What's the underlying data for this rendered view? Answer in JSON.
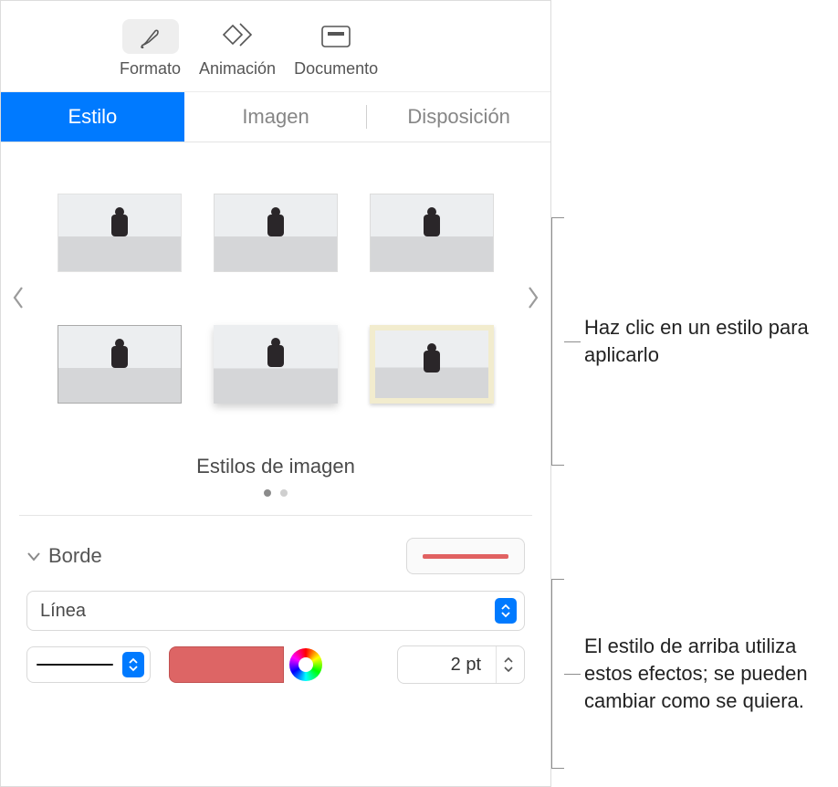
{
  "toolbar": {
    "format": "Formato",
    "animation": "Animación",
    "document": "Documento"
  },
  "subtabs": {
    "style": "Estilo",
    "image": "Imagen",
    "layout": "Disposición"
  },
  "gallery": {
    "caption": "Estilos de imagen"
  },
  "border": {
    "title": "Borde",
    "type": "Línea",
    "size": "2 pt"
  },
  "callouts": {
    "c1": "Haz clic en un estilo para aplicarlo",
    "c2": "El estilo de arriba utiliza estos efectos; se pueden cambiar como se quiera."
  }
}
